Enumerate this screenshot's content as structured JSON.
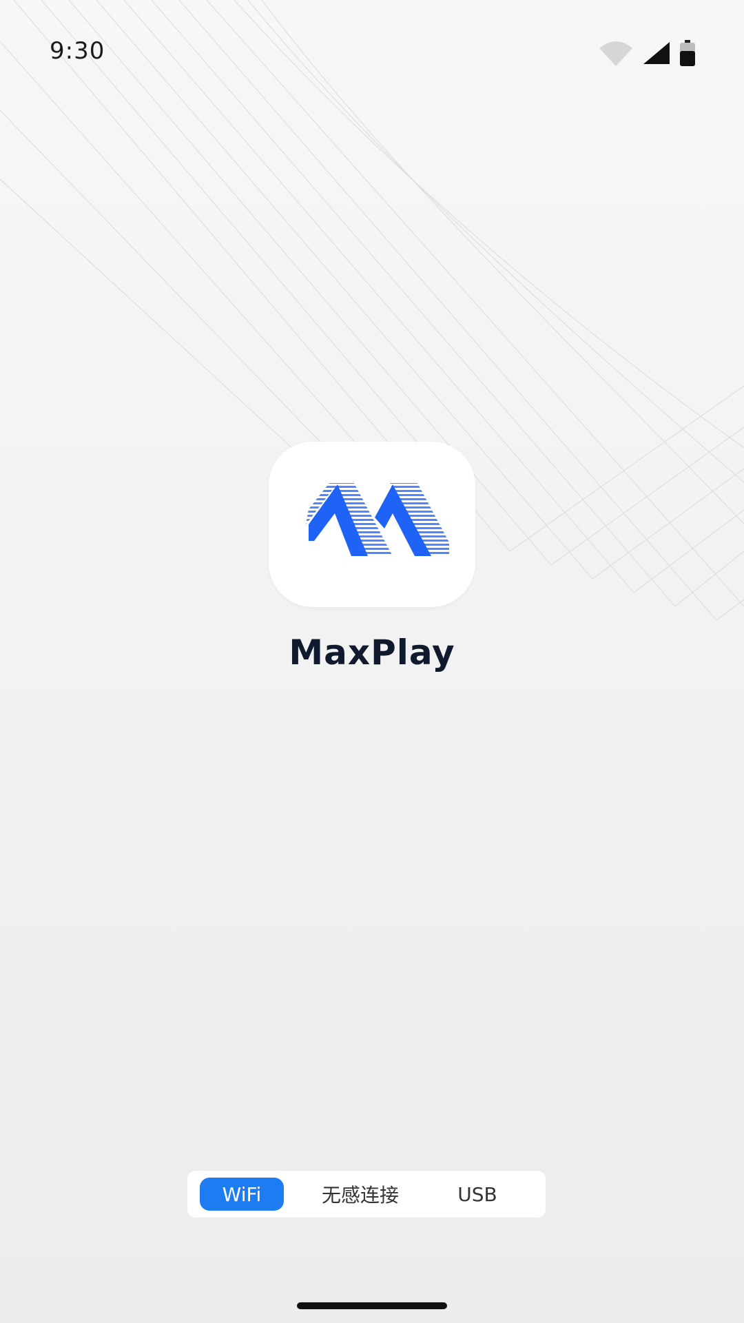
{
  "status_bar": {
    "time": "9:30",
    "icons": [
      "wifi-icon",
      "cellular-signal-icon",
      "battery-icon"
    ]
  },
  "app": {
    "name": "MaxPlay",
    "logo": "maxplay-logo-icon",
    "brand_color": "#1e63f5"
  },
  "mode_switch": {
    "tabs": [
      {
        "label": "WiFi",
        "active": true
      },
      {
        "label": "无感连接",
        "active": false
      },
      {
        "label": "USB",
        "active": false
      }
    ],
    "active_color": "#1e7cf2"
  }
}
